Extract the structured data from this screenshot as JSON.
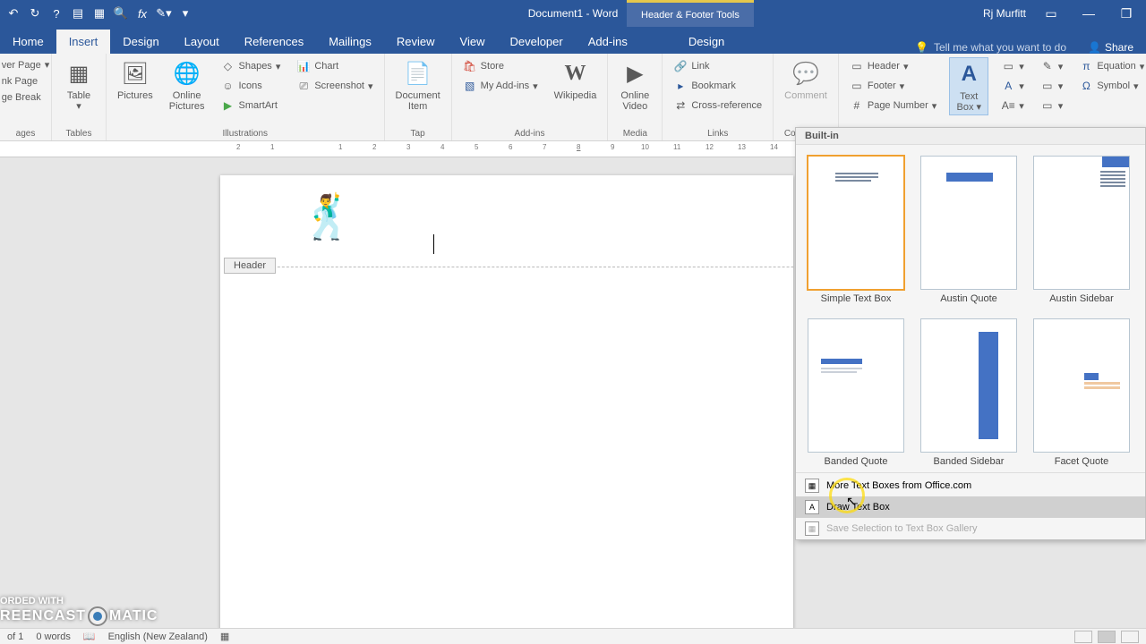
{
  "title": "Document1 - Word",
  "contextual_tab": "Header & Footer Tools",
  "user": "Rj Murfitt",
  "tabs": [
    "Home",
    "Insert",
    "Design",
    "Layout",
    "References",
    "Mailings",
    "Review",
    "View",
    "Developer",
    "Add-ins"
  ],
  "context_tab": "Design",
  "tell_me": "Tell me what you want to do",
  "share": "Share",
  "ribbon": {
    "pages": {
      "label": "ages",
      "cover": "ver Page",
      "blank": "nk Page",
      "break": "ge Break"
    },
    "tables": {
      "label": "Tables",
      "table": "Table"
    },
    "illustrations": {
      "label": "Illustrations",
      "pictures": "Pictures",
      "online": "Online\nPictures",
      "shapes": "Shapes",
      "icons": "Icons",
      "smartart": "SmartArt",
      "chart": "Chart",
      "screenshot": "Screenshot"
    },
    "tap": {
      "label": "Tap",
      "item": "Document\nItem"
    },
    "addins": {
      "label": "Add-ins",
      "store": "Store",
      "myaddins": "My Add-ins",
      "wikipedia": "Wikipedia"
    },
    "media": {
      "label": "Media",
      "video": "Online\nVideo"
    },
    "links": {
      "label": "Links",
      "link": "Link",
      "bookmark": "Bookmark",
      "crossref": "Cross-reference"
    },
    "comments": {
      "label": "Comments",
      "comment": "Comment"
    },
    "headerfooter": {
      "header": "Header",
      "footer": "Footer",
      "pagenum": "Page Number"
    },
    "text": {
      "textbox": "Text\nBox",
      "quickparts": "Quick\nParts"
    },
    "symbols": {
      "equation": "Equation",
      "symbol": "Symbol"
    }
  },
  "doc": {
    "header_tag": "Header"
  },
  "gallery": {
    "header": "Built-in",
    "items": [
      "Simple Text Box",
      "Austin Quote",
      "Austin Sidebar",
      "Banded Quote",
      "Banded Sidebar",
      "Facet Quote"
    ],
    "more": "More Text Boxes from Office.com",
    "draw": "Draw Text Box",
    "save": "Save Selection to Text Box Gallery"
  },
  "status": {
    "page": "of 1",
    "words": "0 words",
    "lang": "English (New Zealand)"
  },
  "watermark": {
    "top": "ORDED WITH",
    "bottom_left": "REENCAST",
    "bottom_right": "MATIC"
  },
  "ruler_marks": [
    "2",
    "1",
    "",
    "1",
    "2",
    "3",
    "4",
    "5",
    "6",
    "7",
    "8",
    "9",
    "10",
    "11",
    "12",
    "13",
    "14"
  ]
}
